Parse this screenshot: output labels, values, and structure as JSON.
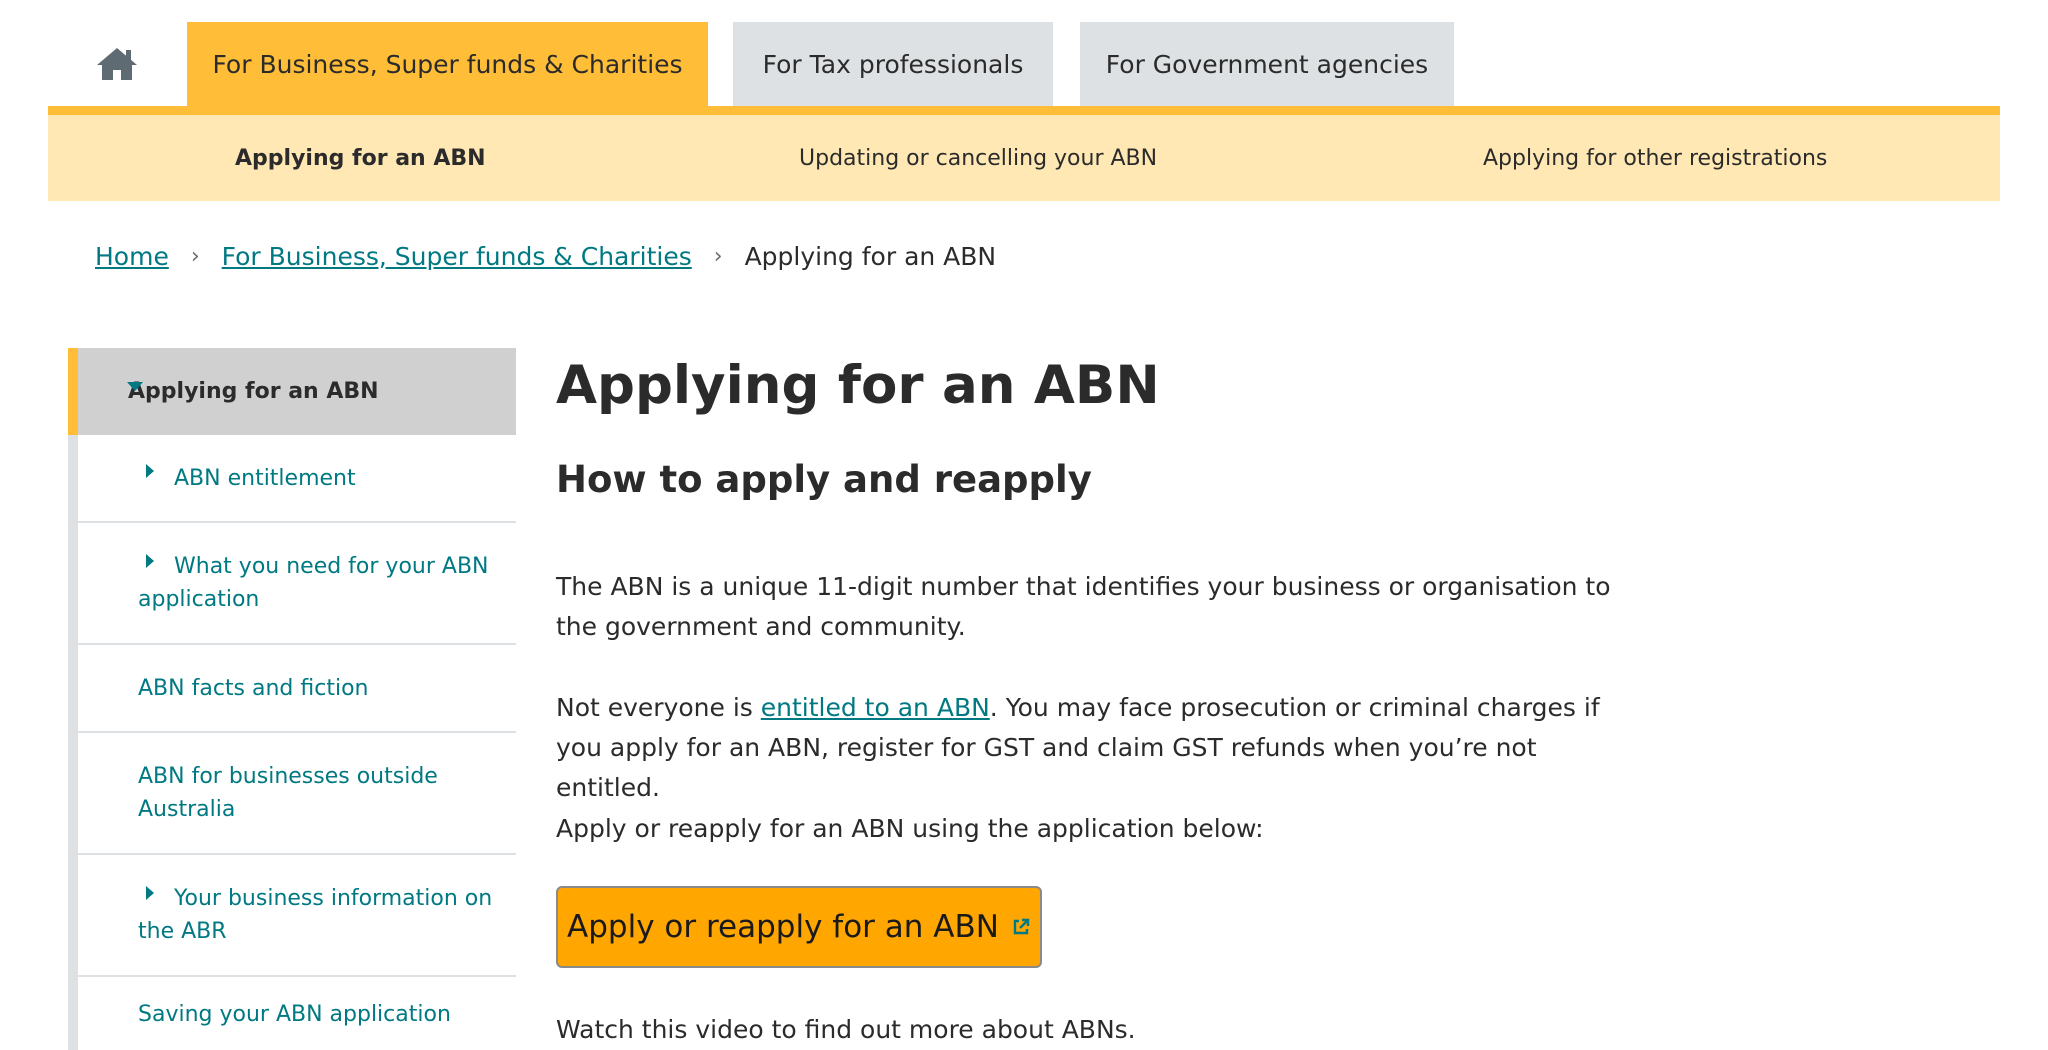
{
  "top_tabs": {
    "home_icon": "home-icon",
    "business": "For Business, Super funds & Charities",
    "tax": "For Tax professionals",
    "government": "For Government agencies"
  },
  "subnav": {
    "applying": "Applying for an ABN",
    "updating": "Updating or cancelling your ABN",
    "other": "Applying for other registrations"
  },
  "breadcrumb": {
    "home": "Home",
    "section": "For Business, Super funds & Charities",
    "current": "Applying for an ABN"
  },
  "sidebar": {
    "active": "Applying for an ABN",
    "items": [
      {
        "label": "ABN entitlement",
        "expandable": true
      },
      {
        "label": "What you need for your ABN application",
        "expandable": true
      },
      {
        "label": "ABN facts and fiction",
        "expandable": false
      },
      {
        "label": "ABN for businesses outside Australia",
        "expandable": false
      },
      {
        "label": "Your business information on the ABR",
        "expandable": true
      },
      {
        "label": "Saving your ABN application",
        "expandable": false
      }
    ]
  },
  "main": {
    "title": "Applying for an ABN",
    "subtitle": "How to apply and reapply",
    "p1": "The ABN is a unique 11-digit number that identifies your business or organisation to the government and community.",
    "p2_before": "Not everyone is ",
    "p2_link": "entitled to an ABN",
    "p2_after": ". You may face prosecution or criminal charges if you apply for an ABN, register for GST and claim GST refunds when you’re not entitled.",
    "p3": "Apply or reapply for an ABN using the application below:",
    "button": "Apply or reapply for an ABN",
    "button_icon": "external-link-icon",
    "p4": "Watch this video to find out more about ABNs."
  },
  "colors": {
    "accent_yellow": "#ffbd38",
    "subnav_bg": "#ffe8b4",
    "link_teal": "#007982",
    "button_orange": "#ffa600"
  }
}
